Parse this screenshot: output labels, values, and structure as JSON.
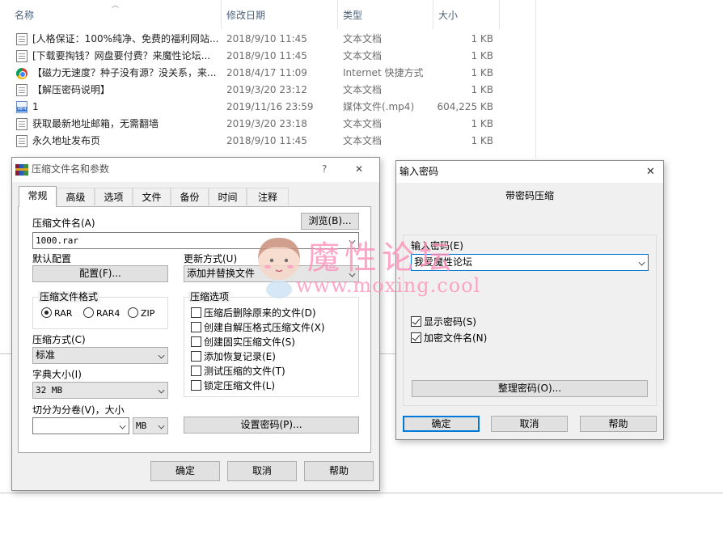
{
  "explorer": {
    "columns": {
      "name": "名称",
      "date": "修改日期",
      "type": "类型",
      "size": "大小"
    },
    "files": [
      {
        "icon": "text-document-icon",
        "name": "[人格保证：100%纯净、免费的福利网站...",
        "date": "2018/9/10 11:45",
        "type": "文本文档",
        "size": "1 KB"
      },
      {
        "icon": "text-document-icon",
        "name": "[下载要掏钱？网盘要付费？来魔性论坛...",
        "date": "2018/9/10 11:45",
        "type": "文本文档",
        "size": "1 KB"
      },
      {
        "icon": "chrome-shortcut-icon",
        "name": "【磁力无速度？种子没有源？没关系，来...",
        "date": "2018/4/17 11:09",
        "type": "Internet 快捷方式",
        "size": "1 KB"
      },
      {
        "icon": "text-document-icon",
        "name": "【解压密码说明】",
        "date": "2019/3/20 23:12",
        "type": "文本文档",
        "size": "1 KB"
      },
      {
        "icon": "mp4-file-icon",
        "name": "1",
        "date": "2019/11/16 23:59",
        "type": "媒体文件(.mp4)",
        "size": "604,225 KB"
      },
      {
        "icon": "text-document-icon",
        "name": "获取最新地址邮箱，无需翻墙",
        "date": "2019/3/20 23:18",
        "type": "文本文档",
        "size": "1 KB"
      },
      {
        "icon": "text-document-icon",
        "name": "永久地址发布页",
        "date": "2018/9/10 11:45",
        "type": "文本文档",
        "size": "1 KB"
      }
    ]
  },
  "archive_dialog": {
    "title": "压缩文件名和参数",
    "help_glyph": "?",
    "close_glyph": "✕",
    "tabs": [
      "常规",
      "高级",
      "选项",
      "文件",
      "备份",
      "时间",
      "注释"
    ],
    "archive_name_label": "压缩文件名(A)",
    "browse_button": "浏览(B)...",
    "archive_name_value": "1000.rar",
    "default_profile_label": "默认配置",
    "profile_button": "配置(F)...",
    "update_mode_label": "更新方式(U)",
    "update_mode_value": "添加并替换文件",
    "format_group": "压缩文件格式",
    "formats": [
      "RAR",
      "RAR4",
      "ZIP"
    ],
    "compression_label": "压缩方式(C)",
    "compression_value": "标准",
    "dict_label": "字典大小(I)",
    "dict_value": "32 MB",
    "split_label": "切分为分卷(V)，大小",
    "split_unit": "MB",
    "options_group": "压缩选项",
    "options": [
      {
        "label": "压缩后删除原来的文件(D)",
        "checked": false
      },
      {
        "label": "创建自解压格式压缩文件(X)",
        "checked": false
      },
      {
        "label": "创建固实压缩文件(S)",
        "checked": false
      },
      {
        "label": "添加恢复记录(E)",
        "checked": false
      },
      {
        "label": "测试压缩的文件(T)",
        "checked": false
      },
      {
        "label": "锁定压缩文件(L)",
        "checked": false
      }
    ],
    "set_password_button": "设置密码(P)...",
    "ok_button": "确定",
    "cancel_button": "取消",
    "help_button": "帮助"
  },
  "password_dialog": {
    "title": "输入密码",
    "close_glyph": "✕",
    "heading": "带密码压缩",
    "password_label": "输入密码(E)",
    "password_value": "我爱魔性论坛",
    "show_password": {
      "label": "显示密码(S)",
      "checked": true
    },
    "encrypt_names": {
      "label": "加密文件名(N)",
      "checked": true
    },
    "organize_button": "整理密码(O)...",
    "ok_button": "确定",
    "cancel_button": "取消",
    "help_button": "帮助"
  },
  "watermark": {
    "title": "魔性论坛",
    "url": "www.moxing.cool"
  },
  "colors": {
    "focus_blue": "#0078d7",
    "dialog_bg": "#f0f0f0",
    "watermark_pink": "#ff8fb8",
    "column_header": "#4c607a"
  }
}
